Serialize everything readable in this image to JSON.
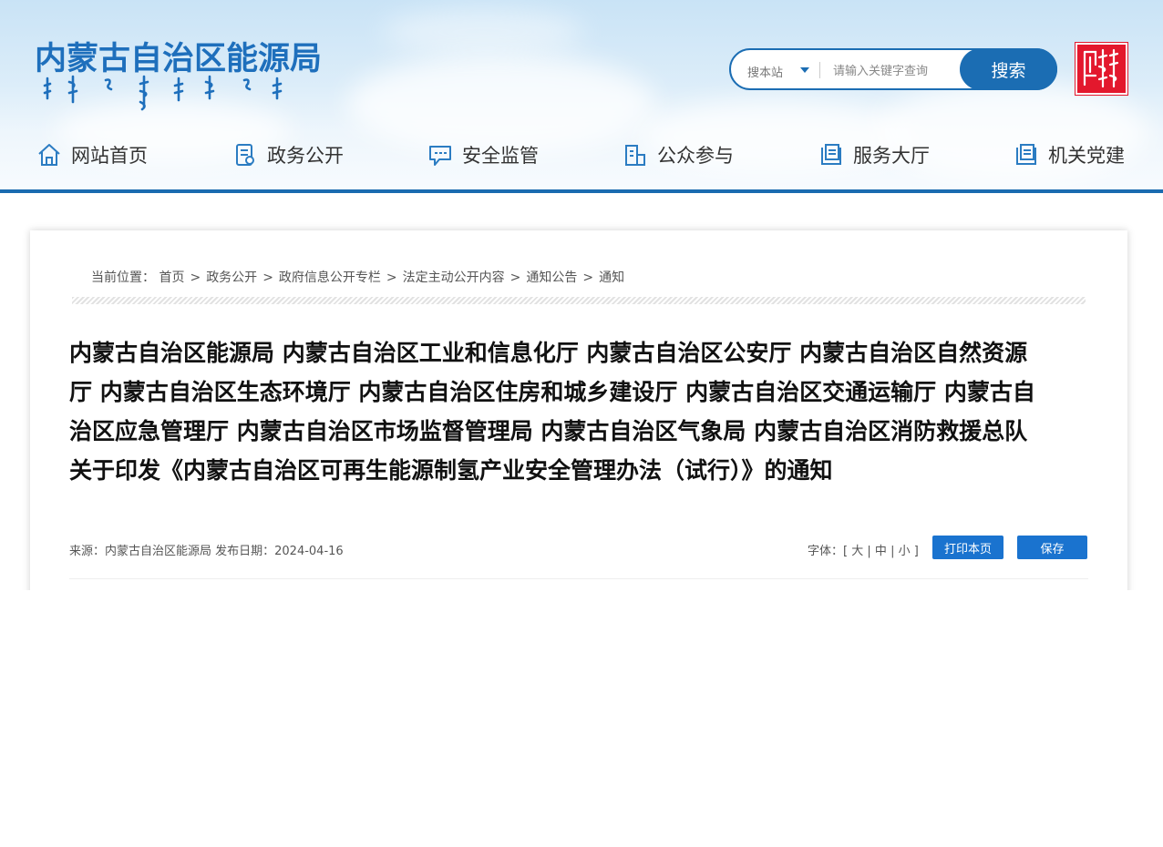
{
  "header": {
    "site_title": "内蒙古自治区能源局",
    "search": {
      "scope": "搜本站",
      "placeholder": "请输入关键字查询",
      "button": "搜索"
    }
  },
  "nav": {
    "items": [
      {
        "label": "网站首页",
        "icon": "home-icon"
      },
      {
        "label": "政务公开",
        "icon": "document-icon"
      },
      {
        "label": "安全监管",
        "icon": "chat-icon"
      },
      {
        "label": "公众参与",
        "icon": "building-icon"
      },
      {
        "label": "服务大厅",
        "icon": "book-icon"
      },
      {
        "label": "机关党建",
        "icon": "book-icon"
      }
    ]
  },
  "breadcrumb": {
    "prefix": "当前位置：",
    "items": [
      "首页",
      "政务公开",
      "政府信息公开专栏",
      "法定主动公开内容",
      "通知公告",
      "通知"
    ],
    "separator": ">"
  },
  "article": {
    "title": "内蒙古自治区能源局 内蒙古自治区工业和信息化厅 内蒙古自治区公安厅 内蒙古自治区自然资源厅 内蒙古自治区生态环境厅 内蒙古自治区住房和城乡建设厅 内蒙古自治区交通运输厅 内蒙古自治区应急管理厅 内蒙古自治区市场监督管理局 内蒙古自治区气象局 内蒙古自治区消防救援总队关于印发《内蒙古自治区可再生能源制氢产业安全管理办法（试行）》的通知",
    "meta": "来源：内蒙古自治区能源局 发布日期：2024-04-16",
    "font_label": "字体：[",
    "font_large": "大",
    "font_medium": "中",
    "font_small": "小",
    "font_close": "]",
    "font_sep": "|",
    "print_button": "打印本页",
    "save_button": "保存"
  },
  "colors": {
    "brand_blue": "#1b6db3",
    "button_blue": "#1a73cf",
    "seal_red": "#e3182d"
  }
}
